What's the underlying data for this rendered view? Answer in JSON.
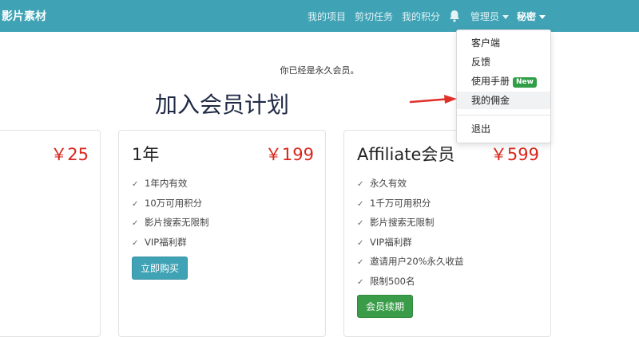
{
  "navbar": {
    "brand": "影片素材",
    "links": [
      "我的项目",
      "剪切任务",
      "我的积分"
    ],
    "admin_label": "管理员",
    "user_label": "秘密"
  },
  "dropdown": {
    "items": [
      "客户端",
      "反馈",
      "使用手册",
      "我的佣金",
      "退出"
    ],
    "new_badge": "New"
  },
  "main": {
    "notice": "你已经是永久会员。",
    "headline": "加入会员计划"
  },
  "plans": [
    {
      "name": "",
      "price": "￥25",
      "features": []
    },
    {
      "name": "1年",
      "price": "￥199",
      "features": [
        "1年内有效",
        "10万可用积分",
        "影片搜索无限制",
        "VIP福利群"
      ],
      "button": "立即购买"
    },
    {
      "name": "Affiliate会员",
      "price": "￥599",
      "features": [
        "永久有效",
        "1千万可用积分",
        "影片搜索无限制",
        "VIP福利群",
        "邀请用户20%永久收益",
        "限制500名"
      ],
      "button": "会员续期"
    }
  ],
  "colors": {
    "navbar": "#3fa3b5",
    "price": "#d9261c",
    "buy_button": "#3fa3b5",
    "renew_button": "#3a9c48",
    "badge": "#2f9e46",
    "arrow": "#e0302a"
  }
}
